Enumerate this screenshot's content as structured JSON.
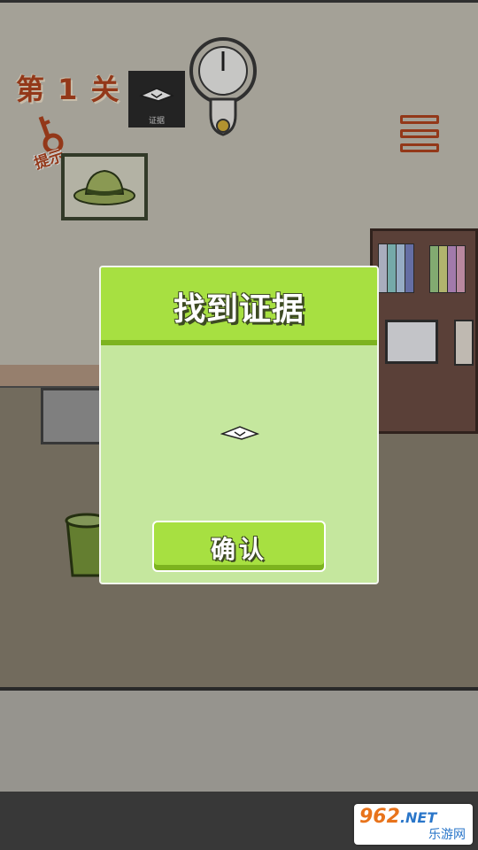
{
  "level": {
    "title": "第 1 关"
  },
  "evidence_slot": {
    "label": "证据",
    "icon": "paper-note-icon"
  },
  "hint": {
    "label": "提示",
    "icon": "key-icon"
  },
  "menu": {
    "icon": "menu-icon"
  },
  "dialog": {
    "title": "找到证据",
    "item_icon": "folded-paper-icon",
    "confirm_label": "确认"
  },
  "watermark": {
    "brand": "962",
    "domain": ".NET",
    "subtitle": "乐游网"
  },
  "colors": {
    "accent_green": "#a7e041",
    "dialog_body": "#c5e79e",
    "level_orange": "#b4451f",
    "wall": "#c9c5b9",
    "floor": "#8b8372"
  }
}
